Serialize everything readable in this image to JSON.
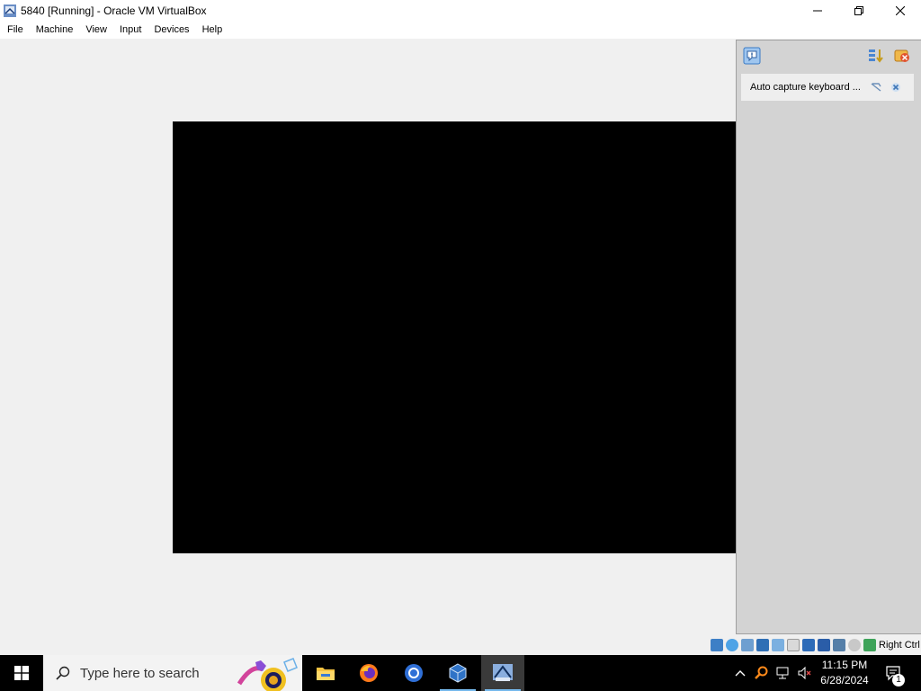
{
  "window": {
    "title": "5840 [Running] - Oracle VM VirtualBox",
    "icon": "virtualbox-vm-icon",
    "controls": [
      "minimize-icon",
      "restore-icon",
      "close-icon"
    ]
  },
  "menu": {
    "items": [
      "File",
      "Machine",
      "View",
      "Input",
      "Devices",
      "Help"
    ]
  },
  "vm_screen": {
    "state": "booting",
    "spinner_color": "#2b8fe6",
    "background": "#000000"
  },
  "notification_panel": {
    "top_icons": [
      "notification-center-icon",
      "sort-icon",
      "dismiss-all-icon"
    ],
    "items": [
      {
        "text": "Auto capture keyboard ...",
        "icons": [
          "toggle-off-icon",
          "close-icon"
        ]
      }
    ]
  },
  "status_bar": {
    "icons": [
      "hard-disk-icon",
      "optical-drive-icon",
      "audio-icon",
      "network-icon",
      "usb-icon",
      "shared-folders-icon",
      "display-icon",
      "recording-icon",
      "cpu-icon",
      "mouse-integration-icon",
      "keyboard-icon"
    ],
    "host_key": "Right Ctrl"
  },
  "taskbar": {
    "search_placeholder": "Type here to search",
    "apps": [
      "file-explorer-icon",
      "firefox-icon",
      "chrome-icon",
      "virtualbox-manager-icon",
      "virtualbox-vm-icon"
    ],
    "tray": {
      "icons": [
        "chevron-up-icon",
        "search-tool-icon",
        "network-icon",
        "volume-muted-icon"
      ],
      "time": "11:15 PM",
      "date": "6/28/2024",
      "notification_count": "1"
    }
  }
}
